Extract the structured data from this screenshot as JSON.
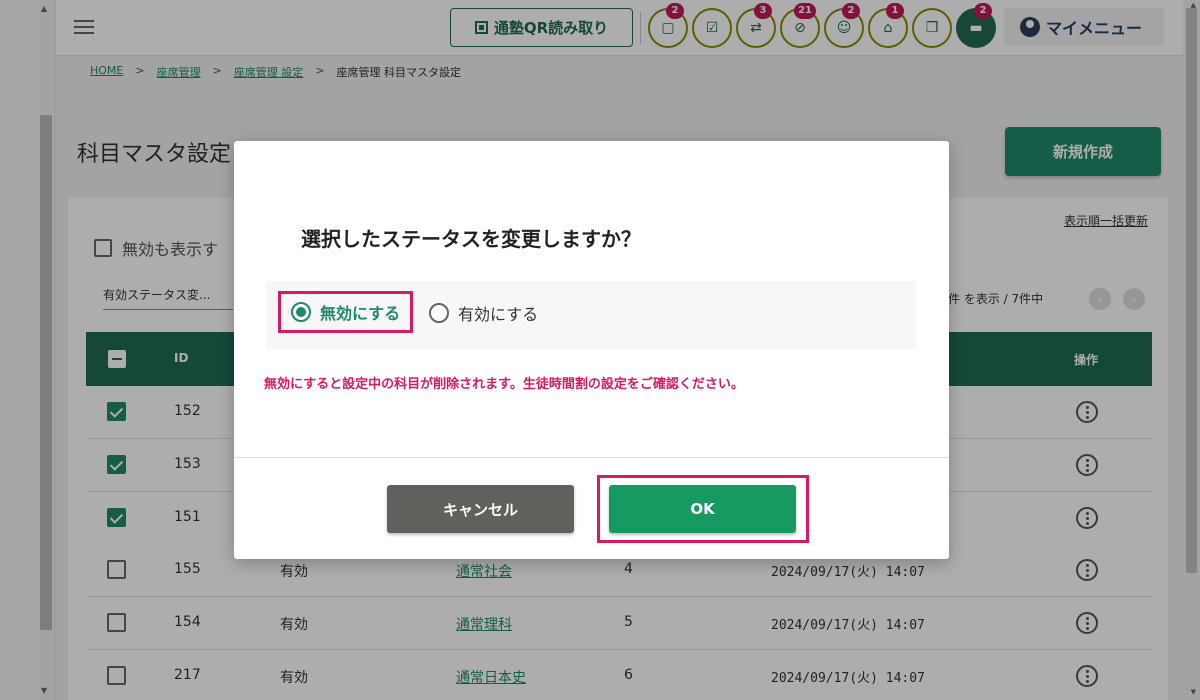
{
  "header": {
    "qr_button_label": "通塾QR読み取り",
    "my_menu_label": "マイメニュー",
    "icons": [
      {
        "name": "message-icon",
        "badge": "2"
      },
      {
        "name": "checklist-icon",
        "badge": ""
      },
      {
        "name": "transfer-icon",
        "badge": "3"
      },
      {
        "name": "blocked-icon",
        "badge": "21"
      },
      {
        "name": "group-icon",
        "badge": "2"
      },
      {
        "name": "school-icon",
        "badge": "1"
      },
      {
        "name": "gift-icon",
        "badge": ""
      },
      {
        "name": "chat-icon",
        "badge": "2"
      }
    ]
  },
  "breadcrumb": {
    "home": "HOME",
    "seat_management": "座席管理",
    "seat_settings": "座席管理 設定",
    "current": "座席管理 科目マスタ設定",
    "separator": ">"
  },
  "page": {
    "title": "科目マスタ設定",
    "new_button": "新規作成",
    "bulk_update_link": "表示順一括更新",
    "show_inactive_label": "無効も表示す",
    "status_select_value": "有効ステータス変...",
    "pager_info": "件 を表示 / 7件中",
    "pager_prev": "‹",
    "pager_next": "›"
  },
  "table": {
    "headers": {
      "id": "ID",
      "operation": "操作"
    },
    "rows": [
      {
        "checked": true,
        "id": "152",
        "status": "",
        "name": "",
        "order": "",
        "date": ""
      },
      {
        "checked": true,
        "id": "153",
        "status": "",
        "name": "",
        "order": "",
        "date": ""
      },
      {
        "checked": true,
        "id": "151",
        "status": "",
        "name": "",
        "order": "",
        "date": ""
      },
      {
        "checked": false,
        "id": "155",
        "status": "有効",
        "name": "通常社会",
        "order": "4",
        "date": "2024/09/17(火) 14:07"
      },
      {
        "checked": false,
        "id": "154",
        "status": "有効",
        "name": "通常理科",
        "order": "5",
        "date": "2024/09/17(火) 14:07"
      },
      {
        "checked": false,
        "id": "217",
        "status": "有効",
        "name": "通常日本史",
        "order": "6",
        "date": "2024/09/17(火) 14:07"
      }
    ]
  },
  "modal": {
    "title": "選択したステータスを変更しますか？",
    "option_disable": "無効にする",
    "option_enable": "有効にする",
    "selected_option": "無効にする",
    "warning": "無効にすると設定中の科目が削除されます。生徒時間割の設定をご確認ください。",
    "cancel_label": "キャンセル",
    "ok_label": "OK"
  },
  "colors": {
    "brand_green": "#1f6b55",
    "button_green": "#179a61",
    "highlight_pink": "#d81b60",
    "cancel_gray": "#5f625c"
  }
}
